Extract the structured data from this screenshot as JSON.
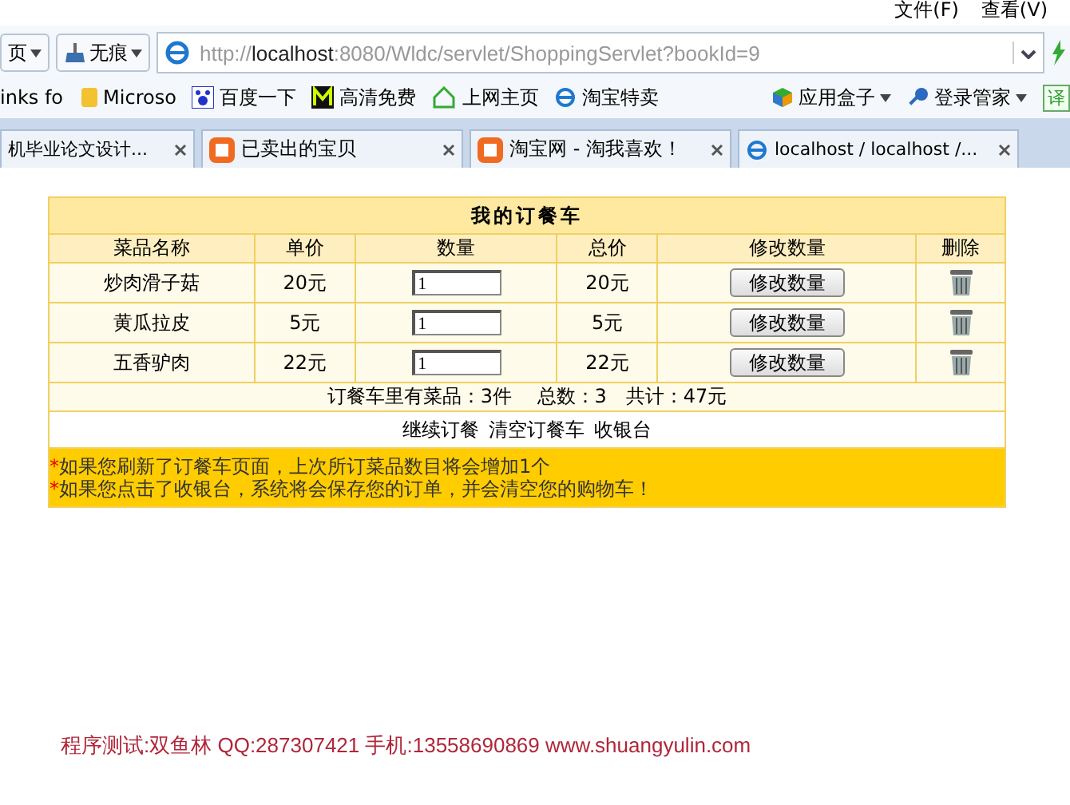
{
  "menu": [
    "文件(F)",
    "查看(V)"
  ],
  "toolbar": {
    "home_button": "页",
    "privacy_button": "无痕",
    "address": {
      "scheme": "http://",
      "host": "localhost",
      "rest": ":8080/Wldc/servlet/ShoppingServlet?bookId=9"
    }
  },
  "bookmarks": [
    {
      "label": "inks fo",
      "kind": "none"
    },
    {
      "label": "Microso",
      "kind": "folder"
    },
    {
      "label": "百度一下",
      "kind": "paw"
    },
    {
      "label": "高清免费",
      "kind": "m"
    },
    {
      "label": "上网主页",
      "kind": "house"
    },
    {
      "label": "淘宝特卖",
      "kind": "ie"
    }
  ],
  "bookmarks_right": [
    {
      "label": "应用盒子",
      "kind": "cube"
    },
    {
      "label": "登录管家",
      "kind": "key"
    }
  ],
  "edge_button": "译",
  "tabs": [
    {
      "label": "机毕业论文设计...",
      "kind": "none",
      "selected": false
    },
    {
      "label": "已卖出的宝贝",
      "kind": "taobao",
      "selected": false
    },
    {
      "label": "淘宝网 - 淘我喜欢！",
      "kind": "taobao",
      "selected": false
    },
    {
      "label": "localhost / localhost /...",
      "kind": "ie",
      "selected": false
    }
  ],
  "cart": {
    "title": "我的订餐车",
    "columns": [
      "菜品名称",
      "单价",
      "数量",
      "总价",
      "修改数量",
      "删除"
    ],
    "rows": [
      {
        "name": "炒肉滑子菇",
        "price": "20元",
        "quantity": "1",
        "total": "20元",
        "button": "修改数量"
      },
      {
        "name": "黄瓜拉皮",
        "price": "5元",
        "quantity": "1",
        "total": "5元",
        "button": "修改数量"
      },
      {
        "name": "五香驴肉",
        "price": "22元",
        "quantity": "1",
        "total": "22元",
        "button": "修改数量"
      }
    ],
    "summary": "订餐车里有菜品：3件　 总数：3　共计：47元",
    "links": [
      "继续订餐",
      "清空订餐车",
      "收银台"
    ],
    "notes": [
      {
        "mark": "*",
        "text": "如果您刷新了订餐车页面，上次所订菜品数目将会增加1个"
      },
      {
        "mark": "*",
        "text": "如果您点击了收银台，系统将会保存您的订单，并会清空您的购物车！"
      }
    ]
  },
  "footer": "程序测试:双鱼林 QQ:287307421 手机:13558690869 www.shuangyulin.com"
}
